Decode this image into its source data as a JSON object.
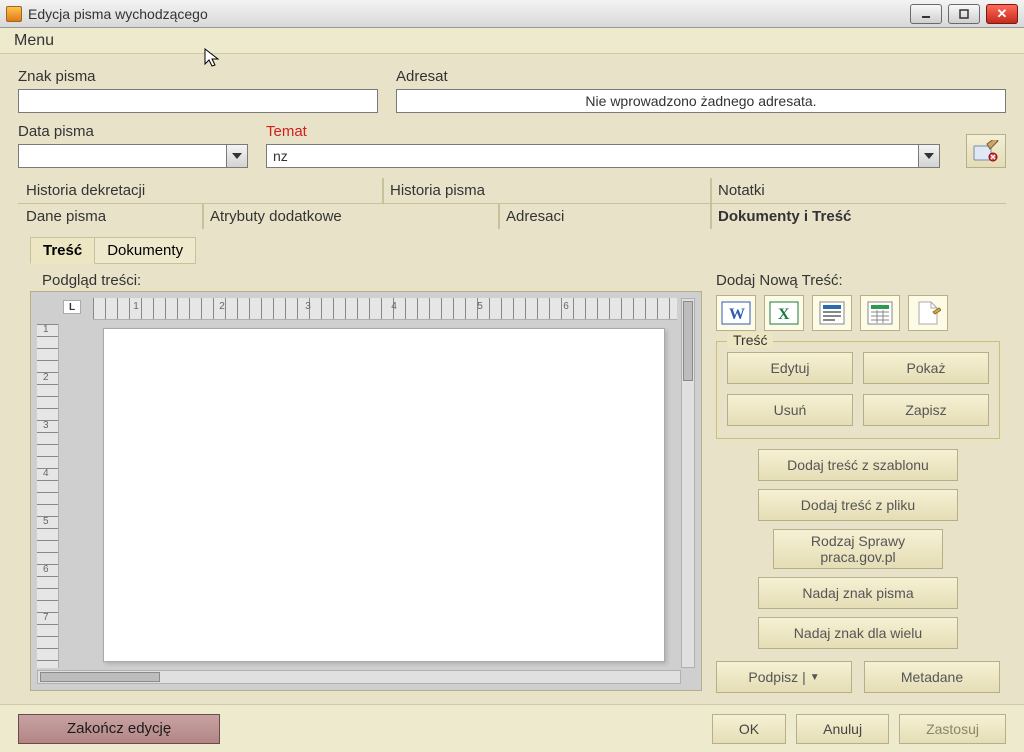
{
  "window": {
    "title": "Edycja pisma wychodzącego"
  },
  "menu": {
    "label": "Menu"
  },
  "fields": {
    "znak_label": "Znak pisma",
    "znak_value": "",
    "adresat_label": "Adresat",
    "adresat_value": "Nie wprowadzono żadnego adresata.",
    "data_label": "Data pisma",
    "data_value": "",
    "temat_label": "Temat",
    "temat_value": "nz"
  },
  "tabs_row1": {
    "t1": "Historia dekretacji",
    "t2": "Historia pisma",
    "t3": "Notatki"
  },
  "tabs_row2": {
    "t1": "Dane pisma",
    "t2": "Atrybuty dodatkowe",
    "t3": "Adresaci",
    "t4": "Dokumenty i Treść"
  },
  "sub_tabs": {
    "tresc": "Treść",
    "dokumenty": "Dokumenty"
  },
  "preview": {
    "label": "Podgląd treści:",
    "ruler_h": [
      "1",
      "2",
      "3",
      "4",
      "5",
      "6"
    ],
    "ruler_v": [
      "1",
      "2",
      "3",
      "4",
      "5",
      "6",
      "7"
    ]
  },
  "right": {
    "add_label": "Dodaj Nową Treść:",
    "tresc_box_title": "Treść",
    "buttons": {
      "edytuj": "Edytuj",
      "pokaz": "Pokaż",
      "usun": "Usuń",
      "zapisz": "Zapisz",
      "szablon": "Dodaj treść z szablonu",
      "plik": "Dodaj treść z pliku",
      "rodzaj": "Rodzaj Sprawy praca.gov.pl",
      "nadaj_znak": "Nadaj znak pisma",
      "nadaj_wielu": "Nadaj znak dla wielu",
      "podpisz": "Podpisz |",
      "metadane": "Metadane"
    },
    "icons": {
      "word": "W",
      "excel": "X"
    }
  },
  "footer": {
    "zakoncz": "Zakończ edycję",
    "ok": "OK",
    "anuluj": "Anuluj",
    "zastosuj": "Zastosuj"
  }
}
